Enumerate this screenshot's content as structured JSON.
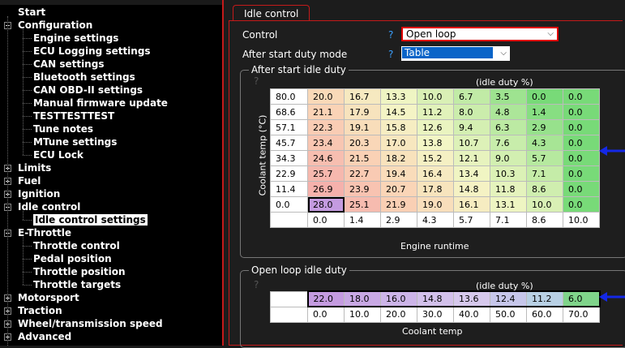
{
  "sidebar": {
    "items": [
      {
        "label": "Start",
        "level": 0,
        "expander": "none"
      },
      {
        "label": "Configuration",
        "level": 0,
        "expander": "minus"
      },
      {
        "label": "Engine settings",
        "level": 1
      },
      {
        "label": "ECU Logging settings",
        "level": 1
      },
      {
        "label": "CAN settings",
        "level": 1
      },
      {
        "label": "Bluetooth settings",
        "level": 1
      },
      {
        "label": "CAN OBD-II settings",
        "level": 1
      },
      {
        "label": "Manual firmware update",
        "level": 1
      },
      {
        "label": "TESTTESTTEST",
        "level": 1
      },
      {
        "label": "Tune notes",
        "level": 1
      },
      {
        "label": "MTune settings",
        "level": 1
      },
      {
        "label": "ECU Lock",
        "level": 1
      },
      {
        "label": "Limits",
        "level": 0,
        "expander": "plus"
      },
      {
        "label": "Fuel",
        "level": 0,
        "expander": "plus"
      },
      {
        "label": "Ignition",
        "level": 0,
        "expander": "plus"
      },
      {
        "label": "Idle control",
        "level": 0,
        "expander": "minus"
      },
      {
        "label": "Idle control settings",
        "level": 1,
        "selected": true
      },
      {
        "label": "E-Throttle",
        "level": 0,
        "expander": "minus"
      },
      {
        "label": "Throttle control",
        "level": 1
      },
      {
        "label": "Pedal position",
        "level": 1
      },
      {
        "label": "Throttle position",
        "level": 1
      },
      {
        "label": "Throttle targets",
        "level": 1
      },
      {
        "label": "Motorsport",
        "level": 0,
        "expander": "plus"
      },
      {
        "label": "Traction",
        "level": 0,
        "expander": "plus"
      },
      {
        "label": "Wheel/transmission speed",
        "level": 0,
        "expander": "plus"
      },
      {
        "label": "Advanced",
        "level": 0,
        "expander": "plus"
      }
    ]
  },
  "tab": {
    "label": "Idle control"
  },
  "form": {
    "control_label": "Control",
    "control_help": "?",
    "control_value": "Open loop",
    "mode_label": "After start duty mode",
    "mode_help": "?",
    "mode_value": "Table"
  },
  "after_start": {
    "title": "After start idle duty",
    "help": "?",
    "unit": "(idle duty %)",
    "y_label": "Coolant temp (°C)",
    "x_label": "Engine runtime",
    "y_axis": [
      "80.0",
      "68.6",
      "57.1",
      "45.7",
      "34.3",
      "22.9",
      "11.4",
      "0.0"
    ],
    "x_axis": [
      "0.0",
      "1.4",
      "2.9",
      "4.3",
      "5.7",
      "7.1",
      "8.6",
      "10.0"
    ],
    "rows": [
      [
        "20.0",
        "16.7",
        "13.3",
        "10.0",
        "6.7",
        "3.5",
        "0.0",
        "0.0"
      ],
      [
        "21.1",
        "17.9",
        "14.5",
        "11.2",
        "8.0",
        "4.8",
        "1.4",
        "0.0"
      ],
      [
        "22.3",
        "19.1",
        "15.8",
        "12.6",
        "9.4",
        "6.3",
        "2.9",
        "0.0"
      ],
      [
        "23.4",
        "20.3",
        "17.0",
        "13.8",
        "10.7",
        "7.6",
        "4.3",
        "0.0"
      ],
      [
        "24.6",
        "21.5",
        "18.2",
        "15.2",
        "12.1",
        "9.0",
        "5.7",
        "0.0"
      ],
      [
        "25.7",
        "22.7",
        "19.4",
        "16.4",
        "13.4",
        "10.3",
        "7.1",
        "0.0"
      ],
      [
        "26.9",
        "23.9",
        "20.7",
        "17.8",
        "14.8",
        "11.8",
        "8.6",
        "0.0"
      ],
      [
        "28.0",
        "25.1",
        "21.9",
        "19.0",
        "16.1",
        "13.1",
        "10.0",
        "0.0"
      ]
    ],
    "selected_cell": [
      7,
      0
    ]
  },
  "open_loop": {
    "title": "Open loop idle duty",
    "help": "?",
    "unit": "(idle duty %)",
    "x_label": "Coolant temp",
    "values": [
      "22.0",
      "18.0",
      "16.0",
      "14.8",
      "13.6",
      "12.4",
      "11.2",
      "6.0"
    ],
    "x_axis": [
      "0.0",
      "10.0",
      "20.0",
      "30.0",
      "40.0",
      "50.0",
      "60.0",
      "70.0"
    ]
  },
  "colors": {
    "accent_red": "#c41a1a",
    "help_blue": "#3aa0ff",
    "select_blue": "#0a64c8",
    "arrow_blue": "#1428e6"
  }
}
